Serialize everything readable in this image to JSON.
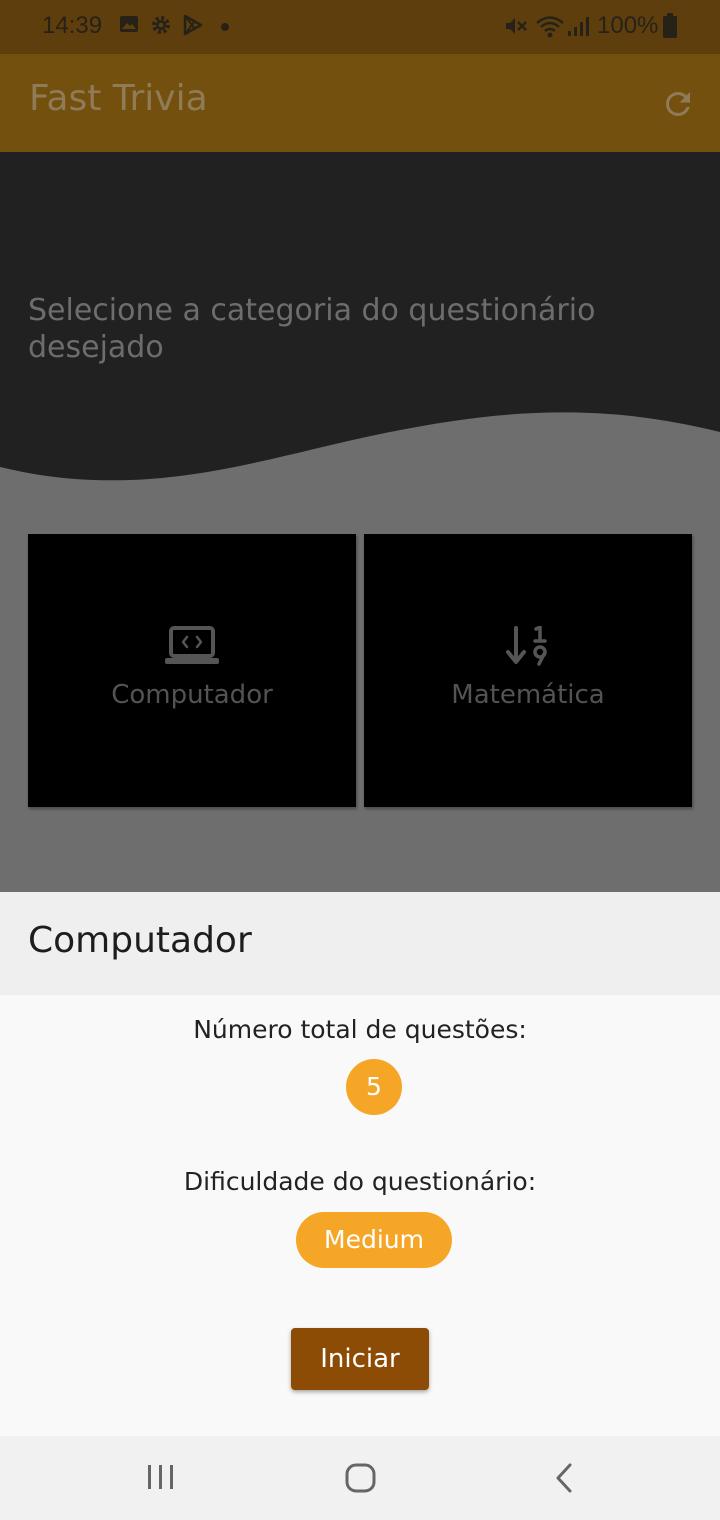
{
  "status_bar": {
    "time": "14:39",
    "battery": "100%",
    "icons": [
      "image-icon",
      "settings-gear-icon",
      "play-store-icon",
      "dot-icon",
      "mute-icon",
      "wifi-icon",
      "signal-icon",
      "battery-icon"
    ]
  },
  "app_bar": {
    "title": "Fast Trivia",
    "refresh_icon": "refresh-icon"
  },
  "hero": {
    "prompt": "Selecione a categoria do questionário desejado"
  },
  "categories": [
    {
      "label": "Computador",
      "icon": "laptop-code-icon"
    },
    {
      "label": "Matemática",
      "icon": "sort-numeric-icon"
    }
  ],
  "sheet": {
    "title": "Computador",
    "questions_label": "Número total de questões:",
    "questions_count": "5",
    "difficulty_label": "Dificuldade do questionário:",
    "difficulty_value": "Medium",
    "start_label": "Iniciar"
  },
  "nav_bar": {
    "icons": [
      "recent-apps-icon",
      "home-icon",
      "back-icon"
    ]
  },
  "colors": {
    "status_bar": "#5f3e0d",
    "app_bar": "#74500f",
    "accent": "#f6a627",
    "start_button": "#8c4c05"
  }
}
